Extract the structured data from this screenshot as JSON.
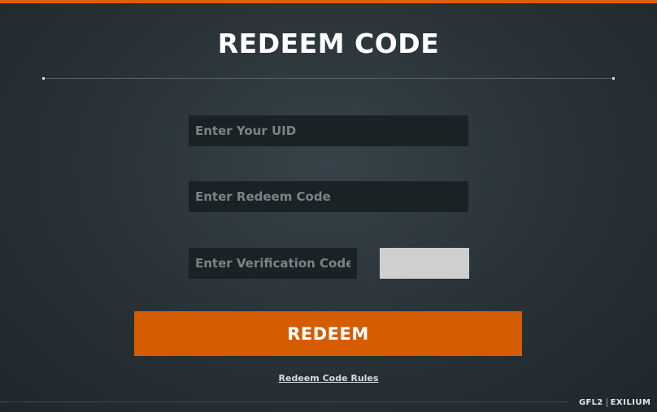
{
  "page": {
    "title": "REDEEM CODE",
    "accent_color": "#e0600a"
  },
  "form": {
    "uid_placeholder": "Enter Your UID",
    "uid_value": "",
    "redeem_code_placeholder": "Enter Redeem Code",
    "redeem_code_value": "",
    "verification_placeholder": "Enter Verification Code",
    "verification_value": "",
    "submit_label": "REDEEM",
    "submit_color": "#d65c00"
  },
  "footer": {
    "rules_link": "Redeem Code Rules",
    "logo_left": "GFL2",
    "logo_right": "EXILIUM"
  }
}
